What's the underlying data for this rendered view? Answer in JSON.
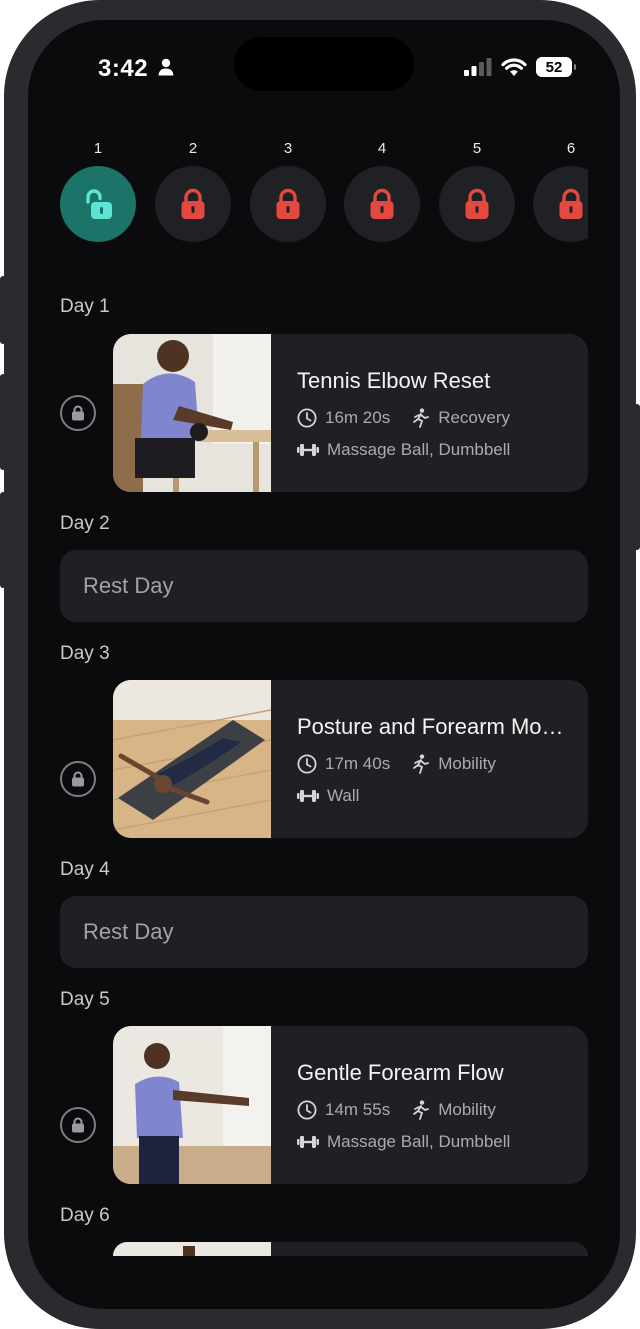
{
  "status_bar": {
    "time": "3:42",
    "battery": "52"
  },
  "program_days": [
    {
      "number": "1",
      "locked": false
    },
    {
      "number": "2",
      "locked": true
    },
    {
      "number": "3",
      "locked": true
    },
    {
      "number": "4",
      "locked": true
    },
    {
      "number": "5",
      "locked": true
    },
    {
      "number": "6",
      "locked": true
    }
  ],
  "schedule": {
    "day1": {
      "label": "Day 1",
      "title": "Tennis Elbow Reset",
      "duration": "16m 20s",
      "category": "Recovery",
      "equipment": "Massage Ball, Dumbbell"
    },
    "day2": {
      "label": "Day 2",
      "rest": "Rest Day"
    },
    "day3": {
      "label": "Day 3",
      "title": "Posture and Forearm Mobility",
      "duration": "17m 40s",
      "category": "Mobility",
      "equipment": "Wall"
    },
    "day4": {
      "label": "Day 4",
      "rest": "Rest Day"
    },
    "day5": {
      "label": "Day 5",
      "title": "Gentle Forearm Flow",
      "duration": "14m 55s",
      "category": "Mobility",
      "equipment": "Massage Ball, Dumbbell"
    },
    "day6": {
      "label": "Day 6"
    }
  },
  "colors": {
    "background": "#0b0b0d",
    "card": "#1e2023",
    "unlocked_day": "#1c7368",
    "unlocked_icon": "#5ee4d4",
    "locked_icon": "#e5483f"
  },
  "icons": {
    "clock": "clock-icon",
    "category": "running-figure-icon",
    "equipment": "dumbbell-icon",
    "lock": "lock-icon",
    "unlock": "unlock-icon"
  }
}
